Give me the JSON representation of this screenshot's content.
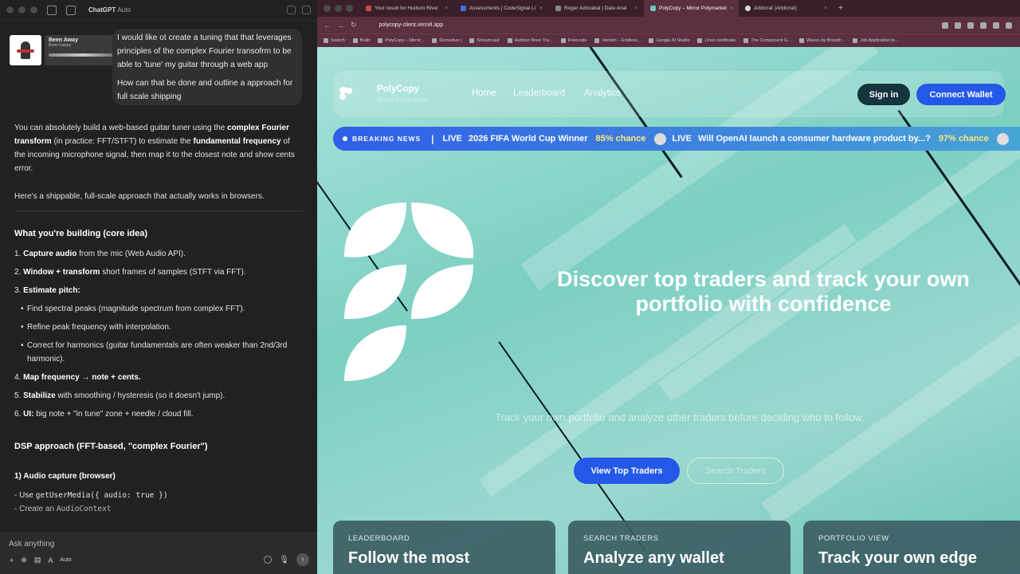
{
  "chat": {
    "app_name": "ChatGPT",
    "app_mode": "Auto",
    "now_playing": {
      "title": "Been Away",
      "artist": "Brent Faiyaz"
    },
    "user_message": {
      "line1": "I would like ot create a tuning that that leverages principles of the complex Fourier transofrm to be able to 'tune' my guitar through a web app",
      "line2": "How can that be done and outline a approach for full scale shipping"
    },
    "response": {
      "intro_a": "You can absolutely build a web-based guitar tuner using the ",
      "intro_b": "complex Fourier transform",
      "intro_c": " (in practice: FFT/STFT) to estimate the ",
      "intro_d": "fundamental frequency",
      "intro_e": " of the incoming microphone signal, then map it to the closest note and show cents error.",
      "intro2": "Here's a shippable, full-scale approach that actually works in browsers.",
      "section1_title": "What you're building (core idea)",
      "steps": [
        {
          "num": "1.",
          "bold": "Capture audio",
          "rest": " from the mic (Web Audio API)."
        },
        {
          "num": "2.",
          "bold": "Window + transform",
          "rest": " short frames of samples (STFT via FFT)."
        },
        {
          "num": "3.",
          "bold": "Estimate pitch:",
          "rest": ""
        }
      ],
      "substeps": [
        "Find spectral peaks (magnitude spectrum from complex FFT).",
        "Refine peak frequency with interpolation.",
        "Correct for harmonics (guitar fundamentals are often weaker than 2nd/3rd harmonic)."
      ],
      "steps2": [
        {
          "num": "4.",
          "bold": "Map frequency → note + cents.",
          "rest": ""
        },
        {
          "num": "5.",
          "bold": "Stabilize",
          "rest": " with smoothing / hysteresis (so it doesn't jump)."
        },
        {
          "num": "6.",
          "bold": "UI:",
          "rest": " big note + \"in tune\" zone + needle / cloud fill."
        }
      ],
      "section2_title": "DSP approach (FFT-based, \"complex Fourier\")",
      "sub_title": "1) Audio capture (browser)",
      "code1_prefix": "- Use ",
      "code1": "getUserMedia({ audio: true })",
      "code2_prefix": "- Create an ",
      "code2": "AudioContext"
    },
    "input": {
      "placeholder": "Ask anything",
      "mode": "Auto"
    }
  },
  "browser": {
    "tabs": [
      {
        "label": "Your result for Hudson River",
        "color": "#c84b4b",
        "active": false
      },
      {
        "label": "Assessments | CodeSignal Li",
        "color": "#3b6fe0",
        "active": false
      },
      {
        "label": "Roger Adrizabal | Data Anal",
        "color": "#888888",
        "active": false
      },
      {
        "label": "PolyCopy – Mirror Polymarket",
        "color": "#6fc4b8",
        "active": true
      },
      {
        "label": "Arbitcrat (Arbitcrat)",
        "color": "#dddddd",
        "active": false
      }
    ],
    "url": "polycopy-client.vercel.app",
    "bookmarks": [
      "Search",
      "Build",
      "PolyCopy – Mirror...",
      "Derivative |",
      "Streamcast",
      "Hudson River Tra...",
      "Freecode",
      "Verisim – Endless...",
      "Google AI Studio",
      "Linux certificate",
      "The Component G...",
      "Waves by Broadc...",
      "Job Application to..."
    ]
  },
  "site": {
    "brand": "PolyCopy",
    "brand_tagline": "Mirror Polymarket",
    "nav": [
      "Home",
      "Leaderboard",
      "Analytics"
    ],
    "sign_in": "Sign in",
    "connect": "Connect Wallet",
    "ticker": {
      "label": "BREAKING NEWS",
      "items": [
        {
          "live": "LIVE",
          "text": "2026 FIFA World Cup Winner",
          "chance": "85% chance"
        },
        {
          "live": "LIVE",
          "text": "Will OpenAI launch a consumer hardware product by...?",
          "chance": "97% chance"
        }
      ]
    },
    "hero": "Discover top traders and track your own portfolio with confidence",
    "subtitle": "Track your own portfolio and analyze other traders before deciding who to follow.",
    "cta_primary": "View Top Traders",
    "cta_secondary": "Search Traders",
    "cards": [
      {
        "kicker": "LEADERBOARD",
        "title": "Follow the most"
      },
      {
        "kicker": "SEARCH TRADERS",
        "title": "Analyze any wallet"
      },
      {
        "kicker": "PORTFOLIO VIEW",
        "title": "Track your own edge"
      }
    ]
  }
}
